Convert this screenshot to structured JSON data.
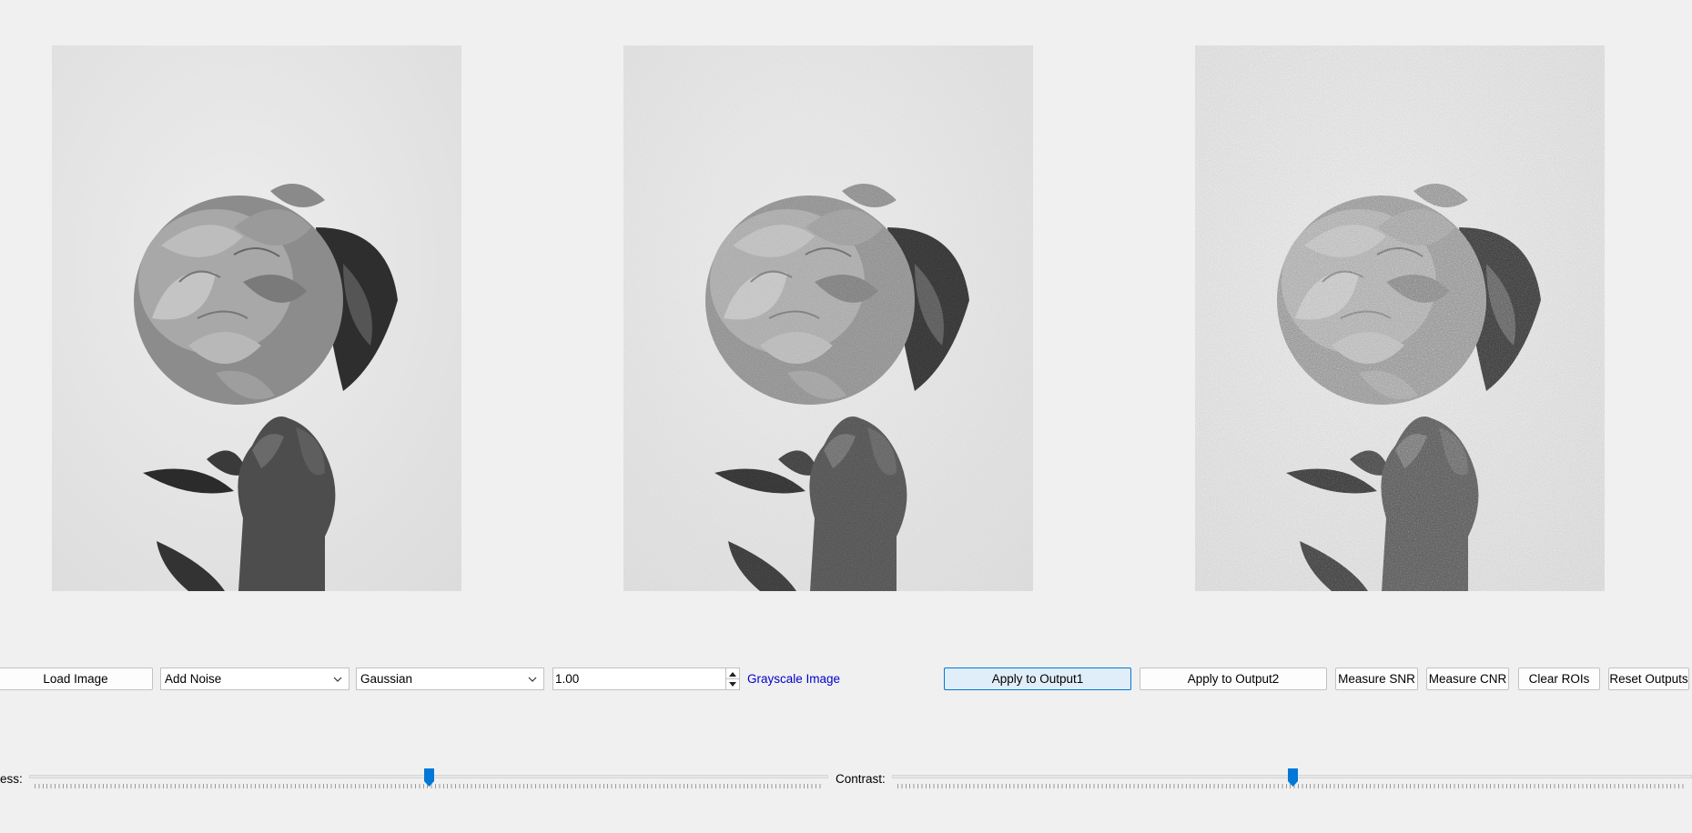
{
  "images": [
    {
      "name": "original",
      "noise": 0
    },
    {
      "name": "output1",
      "noise": 0.35
    },
    {
      "name": "output2",
      "noise": 0.75
    }
  ],
  "toolbar": {
    "load_label": "Load Image",
    "operation": "Add Noise",
    "noise_type": "Gaussian",
    "value": "1.00",
    "grayscale_label": "Grayscale Image",
    "apply1_label": "Apply to Output1",
    "apply2_label": "Apply to Output2",
    "snr_label": "Measure SNR",
    "cnr_label": "Measure CNR",
    "clear_label": "Clear ROIs",
    "reset_label": "Reset Outputs"
  },
  "sliders": {
    "brightness_label": "ess:",
    "brightness_value": 0.5,
    "contrast_label": "Contrast:",
    "contrast_value": 0.5
  },
  "colors": {
    "accent": "#0078d7",
    "link": "#0000cc",
    "background": "#f0f0f0"
  },
  "icons": {
    "dropdown": "chevron-down-icon",
    "spin_up": "arrow-up-icon",
    "spin_down": "arrow-down-icon",
    "slider_handle": "slider-handle-icon"
  }
}
